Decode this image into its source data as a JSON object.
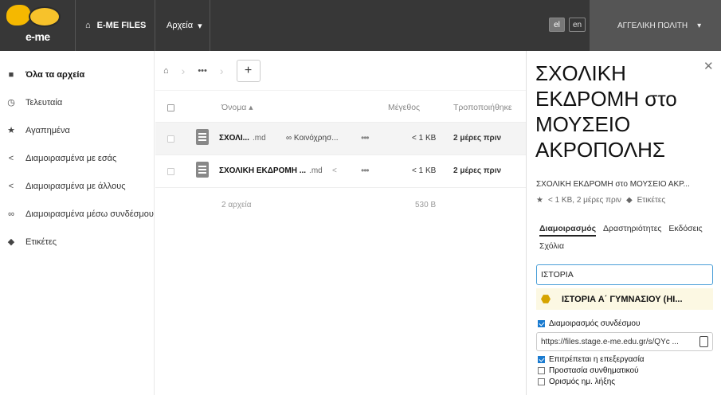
{
  "header": {
    "logo_text": "e-me",
    "brand_label": "E-ME FILES",
    "files_menu_label": "Αρχεία",
    "lang_el": "el",
    "lang_en": "en",
    "user_name": "ΑΓΓΕΛΙΚΗ ΠΟΛΙΤΗ"
  },
  "sidebar": {
    "items": [
      {
        "label": "Όλα τα αρχεία",
        "icon": "folder-icon"
      },
      {
        "label": "Τελευταία",
        "icon": "clock-icon"
      },
      {
        "label": "Αγαπημένα",
        "icon": "star-icon"
      },
      {
        "label": "Διαμοιρασμένα με εσάς",
        "icon": "share-icon"
      },
      {
        "label": "Διαμοιρασμένα με άλλους",
        "icon": "share-icon"
      },
      {
        "label": "Διαμοιρασμένα μέσω συνδέσμου",
        "icon": "link-icon"
      },
      {
        "label": "Ετικέτες",
        "icon": "tag-icon"
      }
    ]
  },
  "breadcrumb": {
    "more": "•••",
    "add": "+"
  },
  "table": {
    "col_name": "Όνομα",
    "col_size": "Μέγεθος",
    "col_modified": "Τροποποιήθηκε",
    "rows": [
      {
        "name": "ΣΧΟΛΙ...",
        "ext": ".md",
        "share_label": "Κοινόχρησ...",
        "size": "< 1 KB",
        "modified": "2 μέρες πριν"
      },
      {
        "name": "ΣΧΟΛΙΚΗ ΕΚΔΡΟΜΗ ...",
        "ext": ".md",
        "share_label": "",
        "size": "< 1 KB",
        "modified": "2 μέρες πριν"
      }
    ],
    "summary_count": "2 αρχεία",
    "summary_size": "530 B"
  },
  "panel": {
    "title": "ΣΧΟΛΙΚΗ ΕΚΔΡΟΜΗ στο ΜΟΥΣΕΙΟ ΑΚΡΟΠΟΛΗΣ",
    "filename": "ΣΧΟΛΙΚΗ ΕΚΔΡΟΜΗ στο ΜΟΥΣΕΙΟ ΑΚΡ...",
    "meta": "< 1 KB, 2 μέρες πριν",
    "tags_label": "Ετικέτες",
    "tabs": [
      "Διαμοιρασμός",
      "Δραστηριότητες",
      "Εκδόσεις",
      "Σχόλια"
    ],
    "search_value": "ΙΣΤΟΡΙΑ",
    "suggestion": "ΙΣΤΟΡΙΑ Α΄ ΓΥΜΝΑΣΙΟΥ (ΗΙ...",
    "link_share_label": "Διαμοιρασμός συνδέσμου",
    "link_url": "https://files.stage.e-me.edu.gr/s/QYc ...",
    "allow_edit_label": "Επιτρέπεται η επεξεργασία",
    "password_label": "Προστασία συνθηματικού",
    "expiry_label": "Ορισμός ημ. λήξης"
  }
}
